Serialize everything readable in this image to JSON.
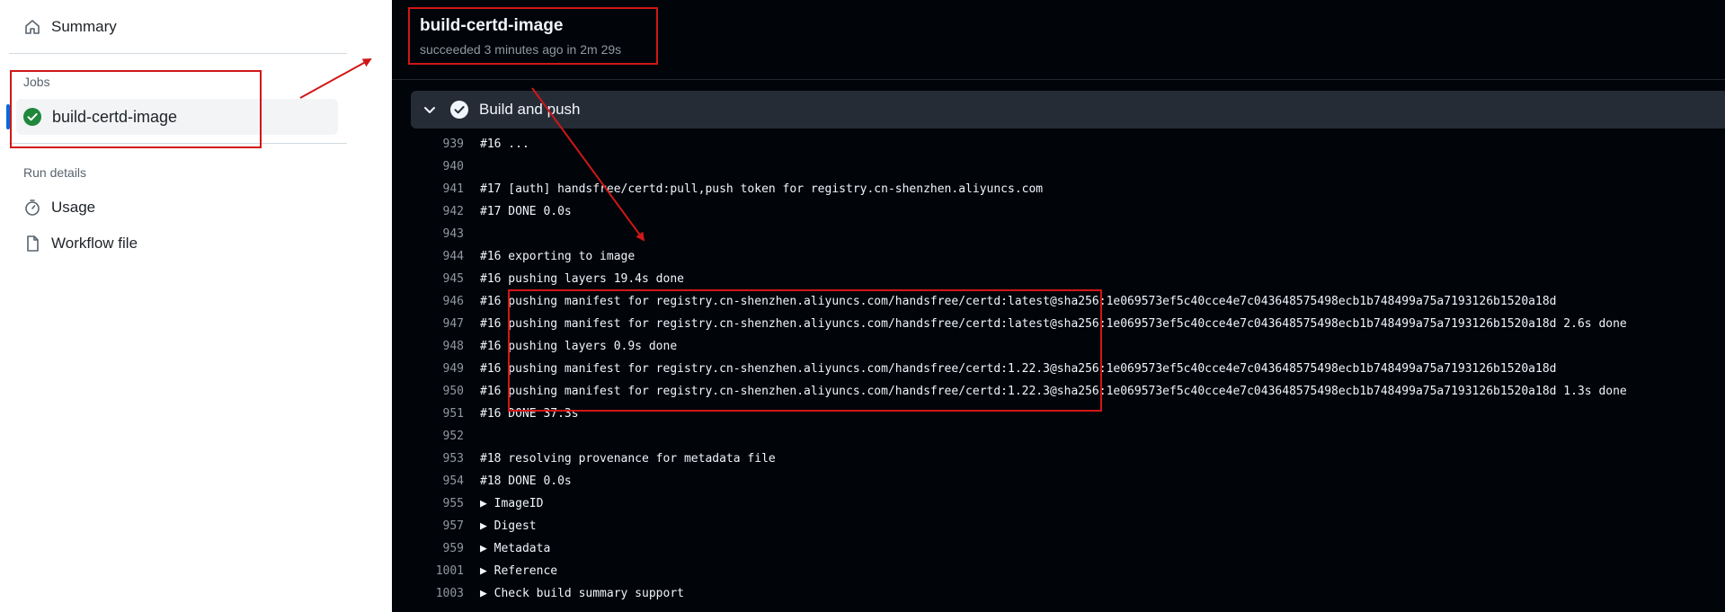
{
  "sidebar": {
    "summary_label": "Summary",
    "jobs_section": "Jobs",
    "job_label": "build-certd-image",
    "run_details_section": "Run details",
    "usage_label": "Usage",
    "workflow_file_label": "Workflow file"
  },
  "main": {
    "job_title": "build-certd-image",
    "job_status": "succeeded 3 minutes ago in 2m 29s",
    "step_label": "Build and push",
    "log_lines": [
      {
        "num": "939",
        "text": "#16 ..."
      },
      {
        "num": "940",
        "text": ""
      },
      {
        "num": "941",
        "text": "#17 [auth] handsfree/certd:pull,push token for registry.cn-shenzhen.aliyuncs.com"
      },
      {
        "num": "942",
        "text": "#17 DONE 0.0s"
      },
      {
        "num": "943",
        "text": ""
      },
      {
        "num": "944",
        "text": "#16 exporting to image"
      },
      {
        "num": "945",
        "text": "#16 pushing layers 19.4s done"
      },
      {
        "num": "946",
        "text": "#16 pushing manifest for registry.cn-shenzhen.aliyuncs.com/handsfree/certd:latest@sha256:1e069573ef5c40cce4e7c043648575498ecb1b748499a75a7193126b1520a18d"
      },
      {
        "num": "947",
        "text": "#16 pushing manifest for registry.cn-shenzhen.aliyuncs.com/handsfree/certd:latest@sha256:1e069573ef5c40cce4e7c043648575498ecb1b748499a75a7193126b1520a18d 2.6s done"
      },
      {
        "num": "948",
        "text": "#16 pushing layers 0.9s done"
      },
      {
        "num": "949",
        "text": "#16 pushing manifest for registry.cn-shenzhen.aliyuncs.com/handsfree/certd:1.22.3@sha256:1e069573ef5c40cce4e7c043648575498ecb1b748499a75a7193126b1520a18d"
      },
      {
        "num": "950",
        "text": "#16 pushing manifest for registry.cn-shenzhen.aliyuncs.com/handsfree/certd:1.22.3@sha256:1e069573ef5c40cce4e7c043648575498ecb1b748499a75a7193126b1520a18d 1.3s done"
      },
      {
        "num": "951",
        "text": "#16 DONE 37.3s"
      },
      {
        "num": "952",
        "text": ""
      },
      {
        "num": "953",
        "text": "#18 resolving provenance for metadata file"
      },
      {
        "num": "954",
        "text": "#18 DONE 0.0s"
      },
      {
        "num": "955",
        "text": "▶ ImageID"
      },
      {
        "num": "957",
        "text": "▶ Digest"
      },
      {
        "num": "959",
        "text": "▶ Metadata"
      },
      {
        "num": "1001",
        "text": "▶ Reference"
      },
      {
        "num": "1003",
        "text": "▶ Check build summary support"
      }
    ]
  },
  "colors": {
    "success": "#1f883d",
    "annotation": "#d01717",
    "accent": "#0969da"
  },
  "icons": {
    "summary": "home-icon",
    "job_status": "check-circle-icon",
    "usage": "stopwatch-icon",
    "workflow_file": "file-icon",
    "step_toggle": "chevron-down-icon",
    "step_status": "check-circle-icon"
  }
}
